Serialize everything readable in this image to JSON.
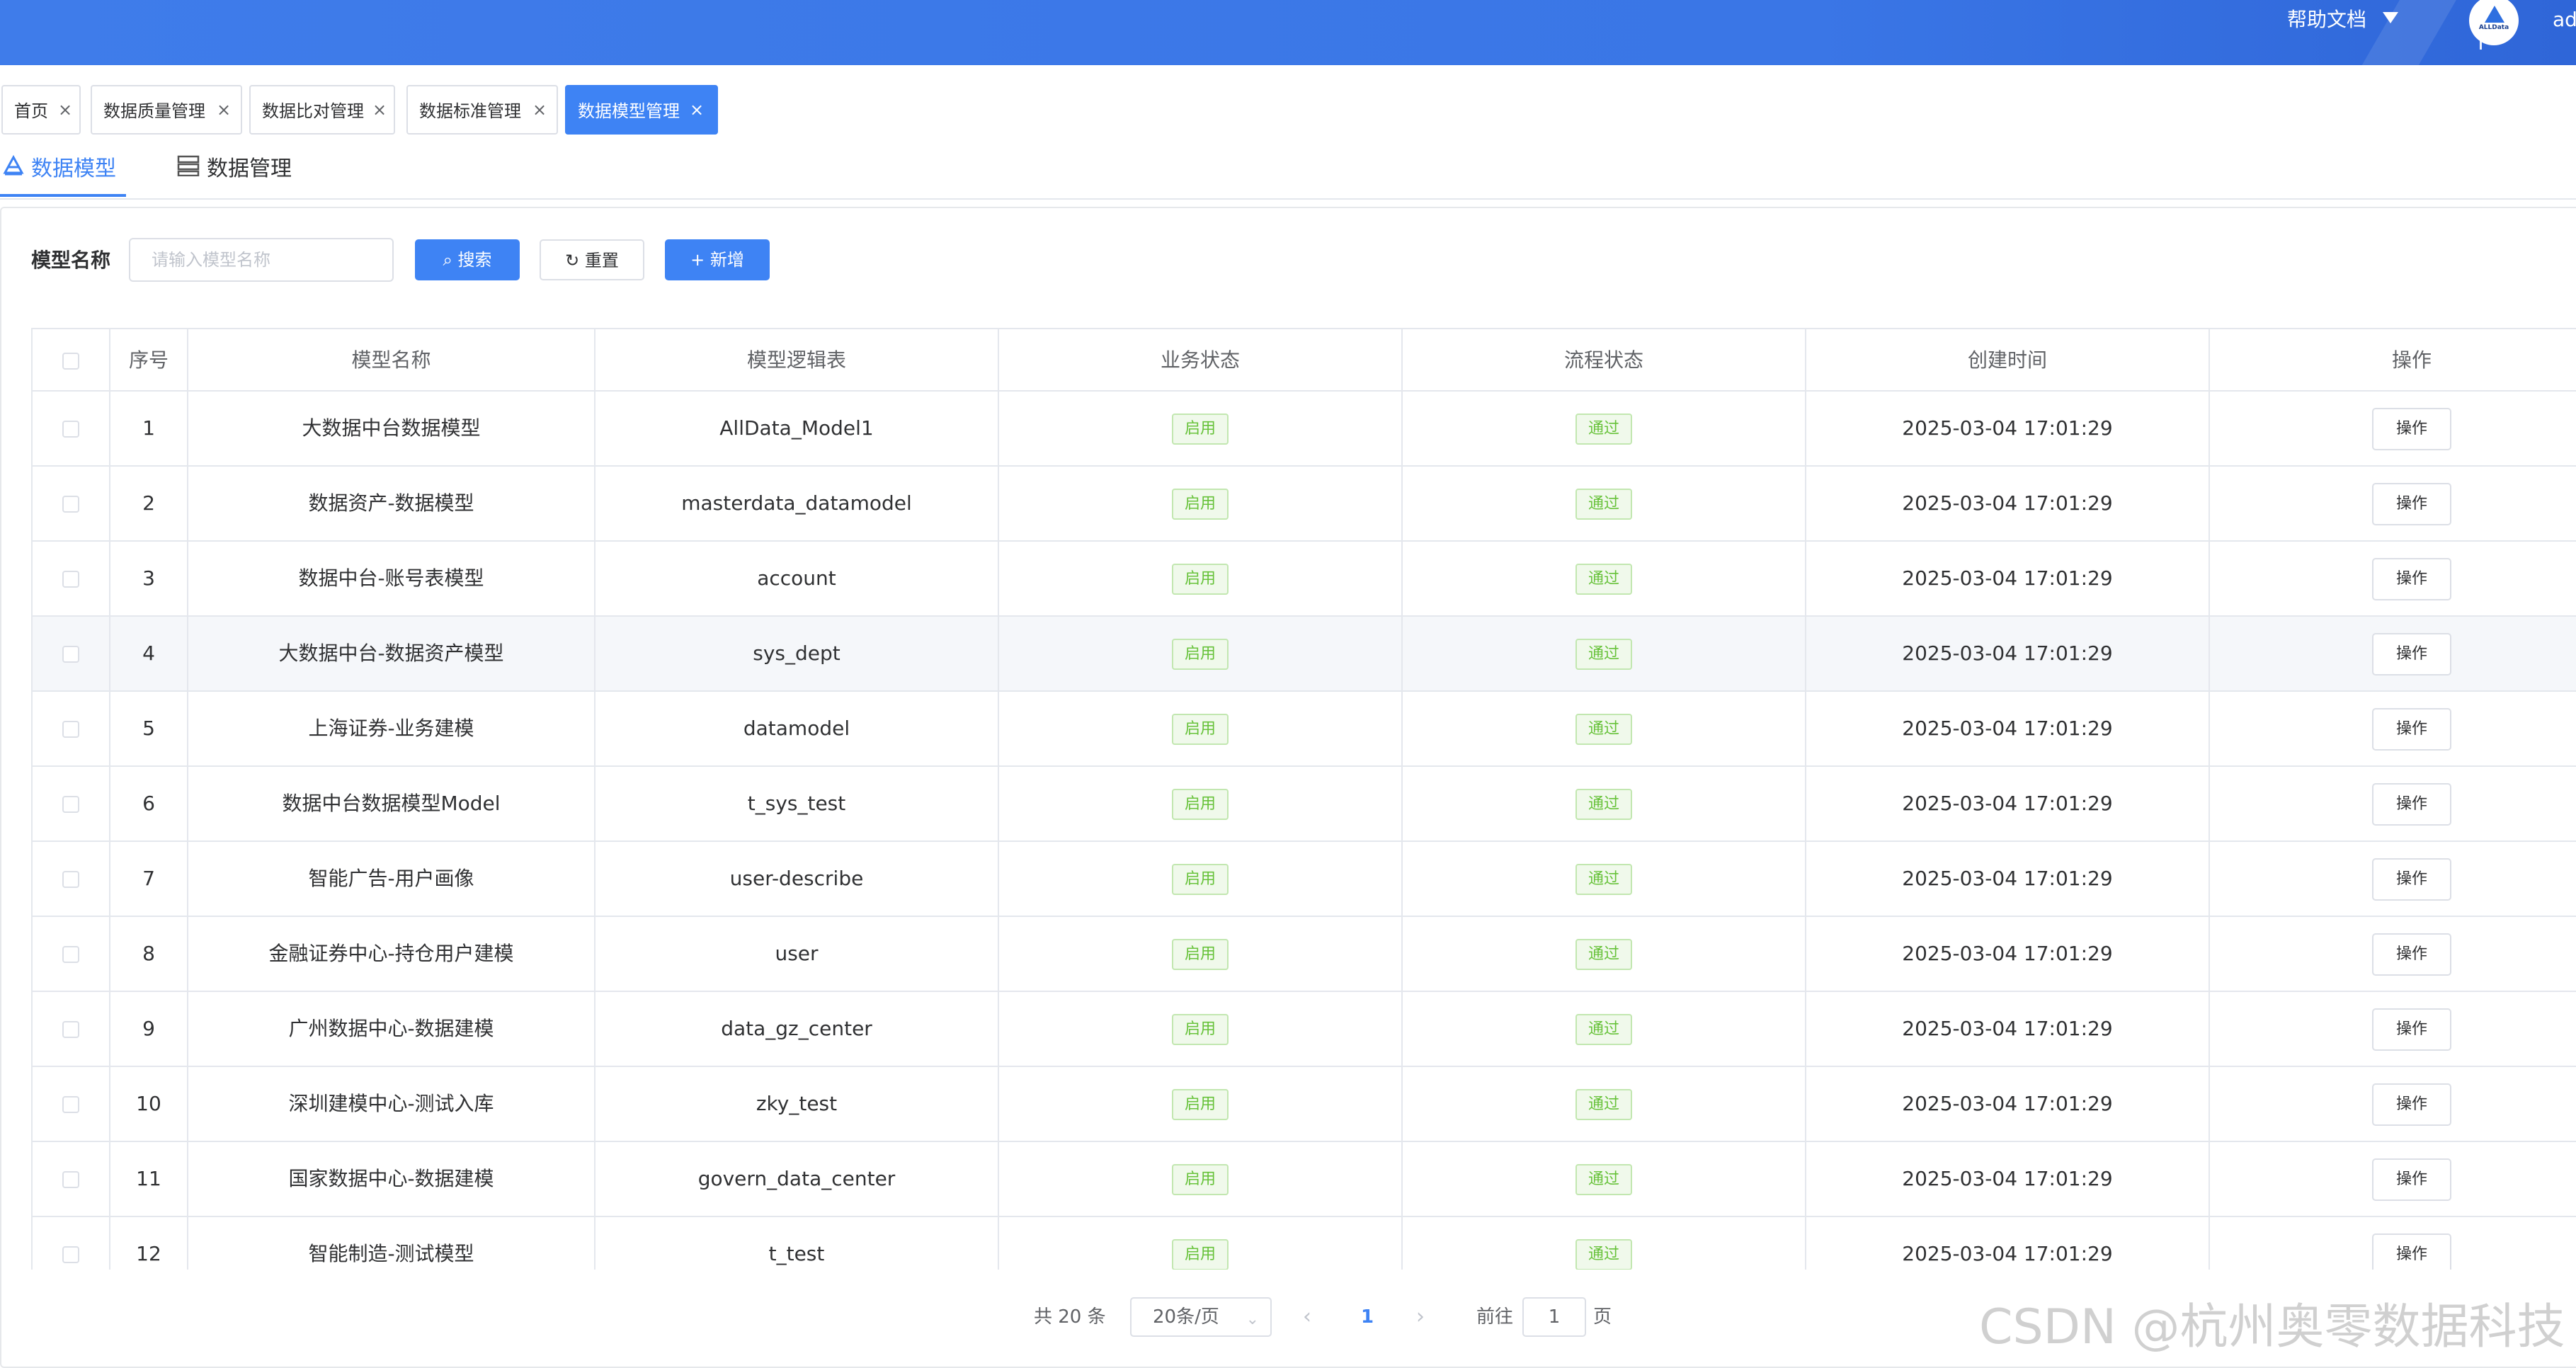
{
  "header": {
    "help_label": "帮助文档",
    "logo_text": "ALLData",
    "user_label": "ad"
  },
  "tags": [
    {
      "label": "首页",
      "active": false
    },
    {
      "label": "数据质量管理",
      "active": false
    },
    {
      "label": "数据比对管理",
      "active": false
    },
    {
      "label": "数据标准管理",
      "active": false
    },
    {
      "label": "数据模型管理",
      "active": true
    }
  ],
  "tabs": [
    {
      "label": "数据模型",
      "active": true,
      "icon": "model-icon"
    },
    {
      "label": "数据管理",
      "active": false,
      "icon": "data-manage-icon"
    }
  ],
  "search": {
    "label": "模型名称",
    "placeholder": "请输入模型名称",
    "value": "",
    "search_button": "搜索",
    "reset_button": "重置",
    "add_button": "新增"
  },
  "table": {
    "columns": [
      "序号",
      "模型名称",
      "模型逻辑表",
      "业务状态",
      "流程状态",
      "创建时间",
      "操作"
    ],
    "rows": [
      {
        "index": "1",
        "name": "大数据中台数据模型",
        "logic_table": "AllData_Model1",
        "biz_status": "启用",
        "flow_status": "通过",
        "created": "2025-03-04 17:01:29",
        "op": "操作"
      },
      {
        "index": "2",
        "name": "数据资产-数据模型",
        "logic_table": "masterdata_datamodel",
        "biz_status": "启用",
        "flow_status": "通过",
        "created": "2025-03-04 17:01:29",
        "op": "操作"
      },
      {
        "index": "3",
        "name": "数据中台-账号表模型",
        "logic_table": "account",
        "biz_status": "启用",
        "flow_status": "通过",
        "created": "2025-03-04 17:01:29",
        "op": "操作"
      },
      {
        "index": "4",
        "name": "大数据中台-数据资产模型",
        "logic_table": "sys_dept",
        "biz_status": "启用",
        "flow_status": "通过",
        "created": "2025-03-04 17:01:29",
        "op": "操作"
      },
      {
        "index": "5",
        "name": "上海证券-业务建模",
        "logic_table": "datamodel",
        "biz_status": "启用",
        "flow_status": "通过",
        "created": "2025-03-04 17:01:29",
        "op": "操作"
      },
      {
        "index": "6",
        "name": "数据中台数据模型Model",
        "logic_table": "t_sys_test",
        "biz_status": "启用",
        "flow_status": "通过",
        "created": "2025-03-04 17:01:29",
        "op": "操作"
      },
      {
        "index": "7",
        "name": "智能广告-用户画像",
        "logic_table": "user-describe",
        "biz_status": "启用",
        "flow_status": "通过",
        "created": "2025-03-04 17:01:29",
        "op": "操作"
      },
      {
        "index": "8",
        "name": "金融证券中心-持仓用户建模",
        "logic_table": "user",
        "biz_status": "启用",
        "flow_status": "通过",
        "created": "2025-03-04 17:01:29",
        "op": "操作"
      },
      {
        "index": "9",
        "name": "广州数据中心-数据建模",
        "logic_table": "data_gz_center",
        "biz_status": "启用",
        "flow_status": "通过",
        "created": "2025-03-04 17:01:29",
        "op": "操作"
      },
      {
        "index": "10",
        "name": "深圳建模中心-测试入库",
        "logic_table": "zky_test",
        "biz_status": "启用",
        "flow_status": "通过",
        "created": "2025-03-04 17:01:29",
        "op": "操作"
      },
      {
        "index": "11",
        "name": "国家数据中心-数据建模",
        "logic_table": "govern_data_center",
        "biz_status": "启用",
        "flow_status": "通过",
        "created": "2025-03-04 17:01:29",
        "op": "操作"
      },
      {
        "index": "12",
        "name": "智能制造-测试模型",
        "logic_table": "t_test",
        "biz_status": "启用",
        "flow_status": "通过",
        "created": "2025-03-04 17:01:29",
        "op": "操作"
      }
    ],
    "highlighted_row_index": 4
  },
  "pagination": {
    "total": "共 20 条",
    "page_size": "20条/页",
    "current_page": "1",
    "goto_label": "前往",
    "goto_value": "1",
    "page_suffix": "页"
  },
  "watermark": "CSDN @杭州奥零数据科技",
  "colors": {
    "primary": "#3e83f4",
    "header": "#3a76e6",
    "success_text": "#67c23a",
    "success_bg": "#f0f9eb"
  }
}
